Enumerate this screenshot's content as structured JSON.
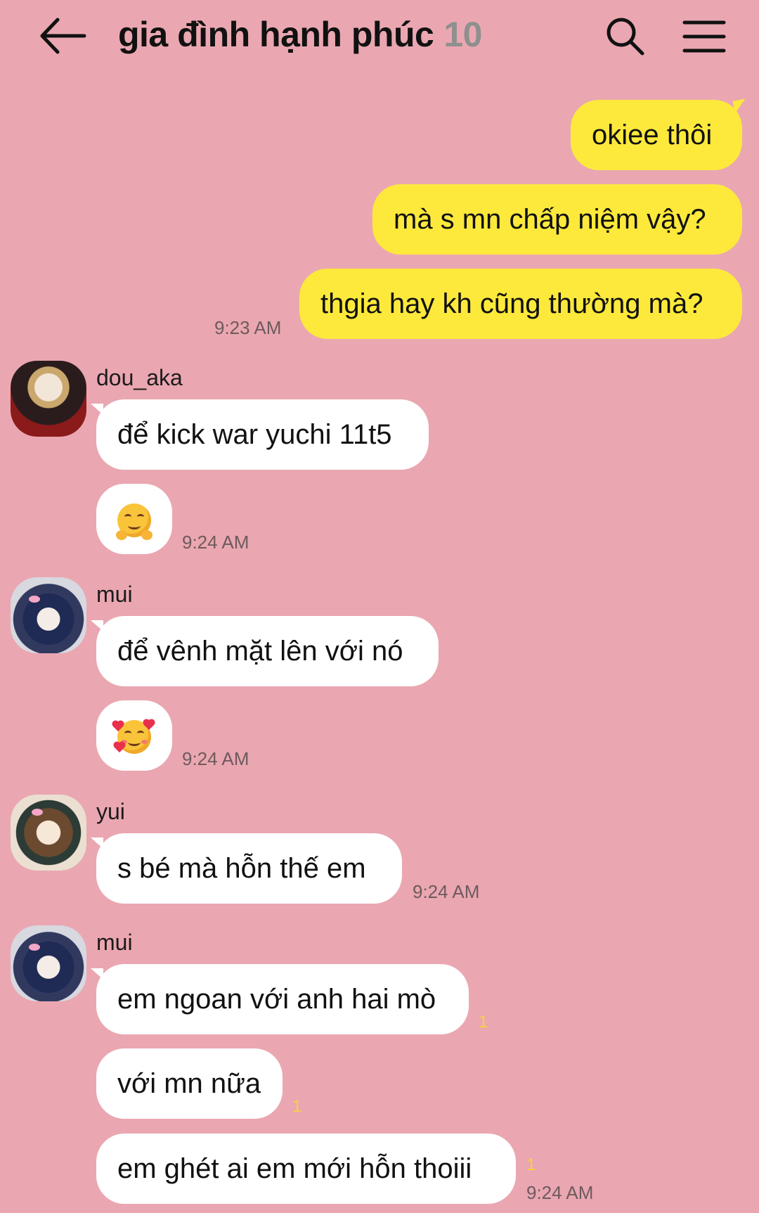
{
  "header": {
    "back_icon": "arrow-left-icon",
    "title": "gia đình hạnh phúc",
    "member_count": "10",
    "search_icon": "search-icon",
    "menu_icon": "hamburger-menu-icon"
  },
  "colors": {
    "background": "#eaa7b1",
    "my_bubble": "#fde93c",
    "their_bubble": "#ffffff",
    "unread": "#f5d33a"
  },
  "outgoing": {
    "messages": [
      "okiee thôi",
      "mà s mn chấp niệm vậy?",
      "thgia hay kh cũng thường mà?"
    ],
    "time": "9:23 AM"
  },
  "groups": {
    "dou": {
      "sender": "dou_aka",
      "message": "để kick war yuchi 11t5",
      "emoji": "smiling-face-with-open-hands",
      "time": "9:24 AM"
    },
    "mui1": {
      "sender": "mui",
      "message": "để vênh mặt lên với nó",
      "emoji": "smiling-face-with-hearts",
      "time": "9:24 AM"
    },
    "yui": {
      "sender": "yui",
      "message": "s bé mà hỗn thế em",
      "time": "9:24 AM"
    },
    "mui2": {
      "sender": "mui",
      "messages": [
        "em ngoan với anh hai mò",
        "với mn nữa",
        "em ghét ai em mới hỗn thoiii"
      ],
      "unread": [
        "1",
        "1",
        "1"
      ],
      "time": "9:24 AM"
    }
  }
}
